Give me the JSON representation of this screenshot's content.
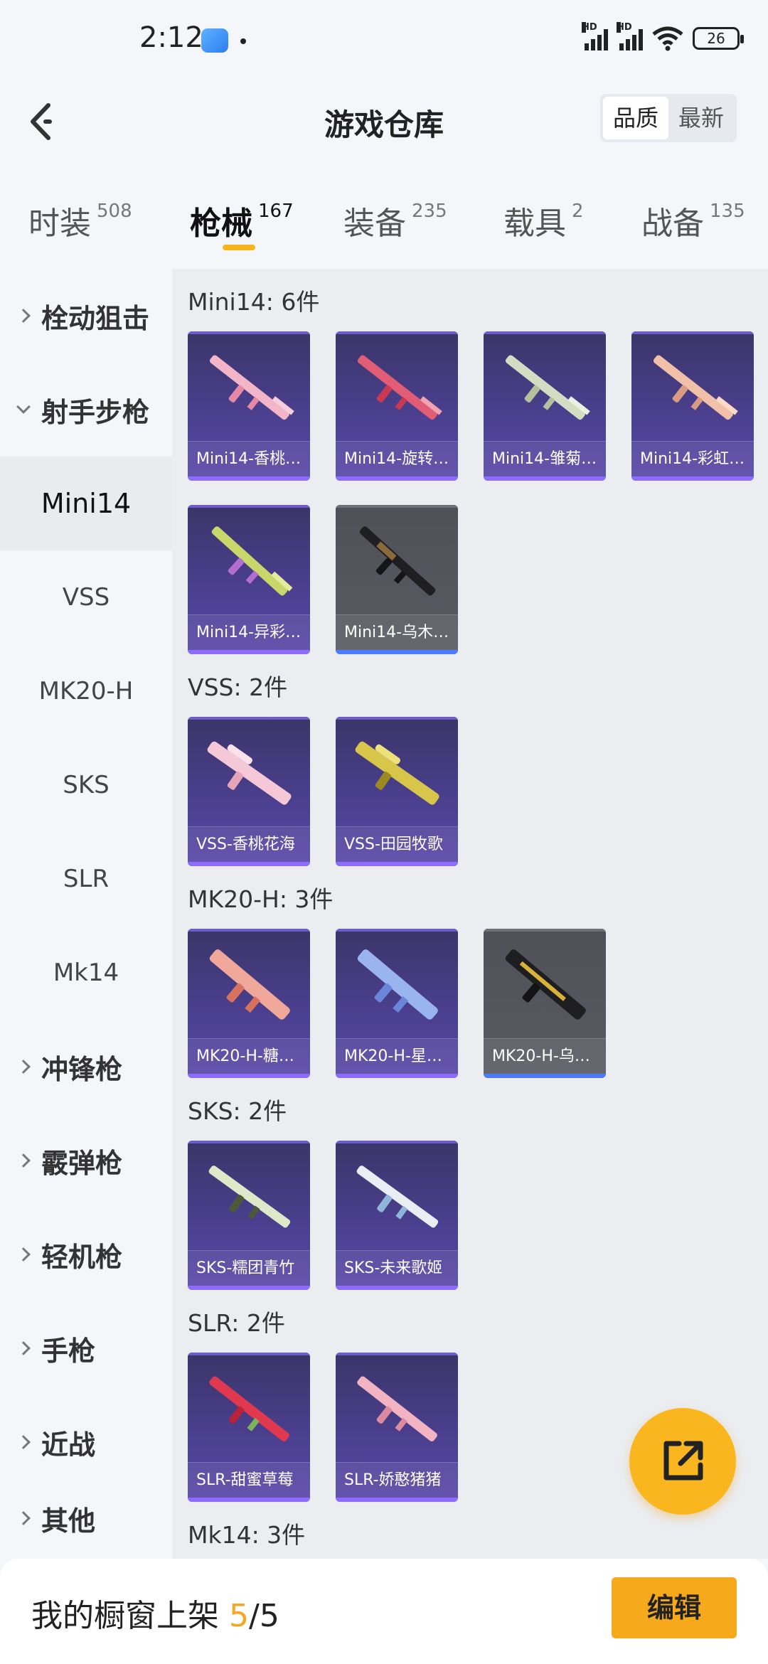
{
  "status_bar": {
    "time": "2:12",
    "battery": "26",
    "hd": "HD"
  },
  "header": {
    "title": "游戏仓库",
    "sort_options": [
      "品质",
      "最新"
    ]
  },
  "category_tabs": [
    {
      "label": "时装",
      "count": "508"
    },
    {
      "label": "枪械",
      "count": "167"
    },
    {
      "label": "装备",
      "count": "235"
    },
    {
      "label": "载具",
      "count": "2"
    },
    {
      "label": "战备",
      "count": "135"
    }
  ],
  "sidebar": {
    "items": [
      {
        "label": "栓动狙击"
      },
      {
        "label": "射手步枪"
      },
      {
        "label": "Mini14"
      },
      {
        "label": "VSS"
      },
      {
        "label": "MK20-H"
      },
      {
        "label": "SKS"
      },
      {
        "label": "SLR"
      },
      {
        "label": "Mk14"
      },
      {
        "label": "冲锋枪"
      },
      {
        "label": "霰弹枪"
      },
      {
        "label": "轻机枪"
      },
      {
        "label": "手枪"
      },
      {
        "label": "近战"
      },
      {
        "label": "其他"
      }
    ]
  },
  "sections": [
    {
      "title": "Mini14: 6件",
      "cards": [
        "Mini14-香桃…",
        "Mini14-旋转…",
        "Mini14-雏菊…",
        "Mini14-彩虹…",
        "Mini14-异彩…",
        "Mini14-乌木…"
      ]
    },
    {
      "title": "VSS: 2件",
      "cards": [
        "VSS-香桃花海",
        "VSS-田园牧歌"
      ]
    },
    {
      "title": "MK20-H: 3件",
      "cards": [
        "MK20-H-糖…",
        "MK20-H-星…",
        "MK20-H-乌…"
      ]
    },
    {
      "title": "SKS: 2件",
      "cards": [
        "SKS-糯团青竹",
        "SKS-未来歌姬"
      ]
    },
    {
      "title": "SLR: 2件",
      "cards": [
        "SLR-甜蜜草莓",
        "SLR-娇憨猪猪"
      ]
    },
    {
      "title": "Mk14: 3件"
    }
  ],
  "bottom_bar": {
    "shelf_label": "我的橱窗上架 ",
    "shelf_count": "5",
    "shelf_total": "/5",
    "edit_label": "编辑"
  },
  "colors": {
    "accent": "#f5b41b",
    "card_purple": "#4b3f8e",
    "card_grey": "#55555e"
  },
  "icons": [
    "back-arrow-icon",
    "signal-icon",
    "wifi-icon",
    "battery-icon",
    "chevron-right-icon",
    "chevron-down-icon",
    "share-external-icon"
  ]
}
